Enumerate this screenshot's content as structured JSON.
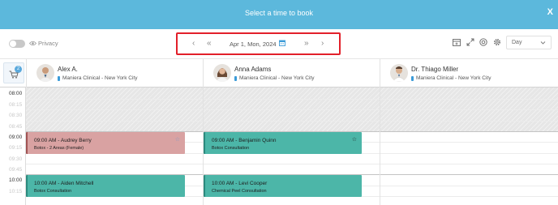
{
  "header": {
    "title": "Select a time to book",
    "close_label": "X"
  },
  "toolbar": {
    "privacy_label": "Privacy",
    "date_label": "Apr 1, Mon, 2024",
    "prev_label": "‹",
    "prev_fast_label": "«",
    "next_fast_label": "»",
    "next_label": "›",
    "view_value": "Day"
  },
  "cart": {
    "count": "2"
  },
  "providers": [
    {
      "name": "Alex A.",
      "location": "Maniera Clinical - New York City"
    },
    {
      "name": "Anna Adams",
      "location": "Maniera Clinical - New York City"
    },
    {
      "name": "Dr. Thiago Miller",
      "location": "Maniera Clinical - New York City"
    }
  ],
  "times": {
    "t0800": "08:00",
    "t0815": "08:15",
    "t0830": "08:30",
    "t0845": "08:45",
    "t0900": "09:00",
    "t0915": "09:15",
    "t0930": "09:30",
    "t0945": "09:45",
    "t1000": "10:00",
    "t1015": "10:15"
  },
  "appointments": [
    {
      "title": "09:00 AM - Audrey Berry",
      "service": "Botox - 2 Areas (Female)",
      "color": "#d9a2a2",
      "accent": "#a05353",
      "star": "☆"
    },
    {
      "title": "09:00 AM - Benjamin Quinn",
      "service": "Botox Consultation",
      "color": "#4cb6a8",
      "accent": "#2c8a7e",
      "star": "☆"
    },
    {
      "title": "10:00 AM - Aiden Mitchell",
      "service": "Botox Consultation",
      "color": "#4cb6a8",
      "accent": "#2c8a7e"
    },
    {
      "title": "10:00 AM - Levi Cooper",
      "service": "Chemical Peel Consultation",
      "color": "#4cb6a8",
      "accent": "#2c8a7e"
    }
  ],
  "colors": {
    "header_bg": "#5cb8dc",
    "highlight_border": "#e2202a",
    "blocked_bg": "#e6e6e6"
  }
}
